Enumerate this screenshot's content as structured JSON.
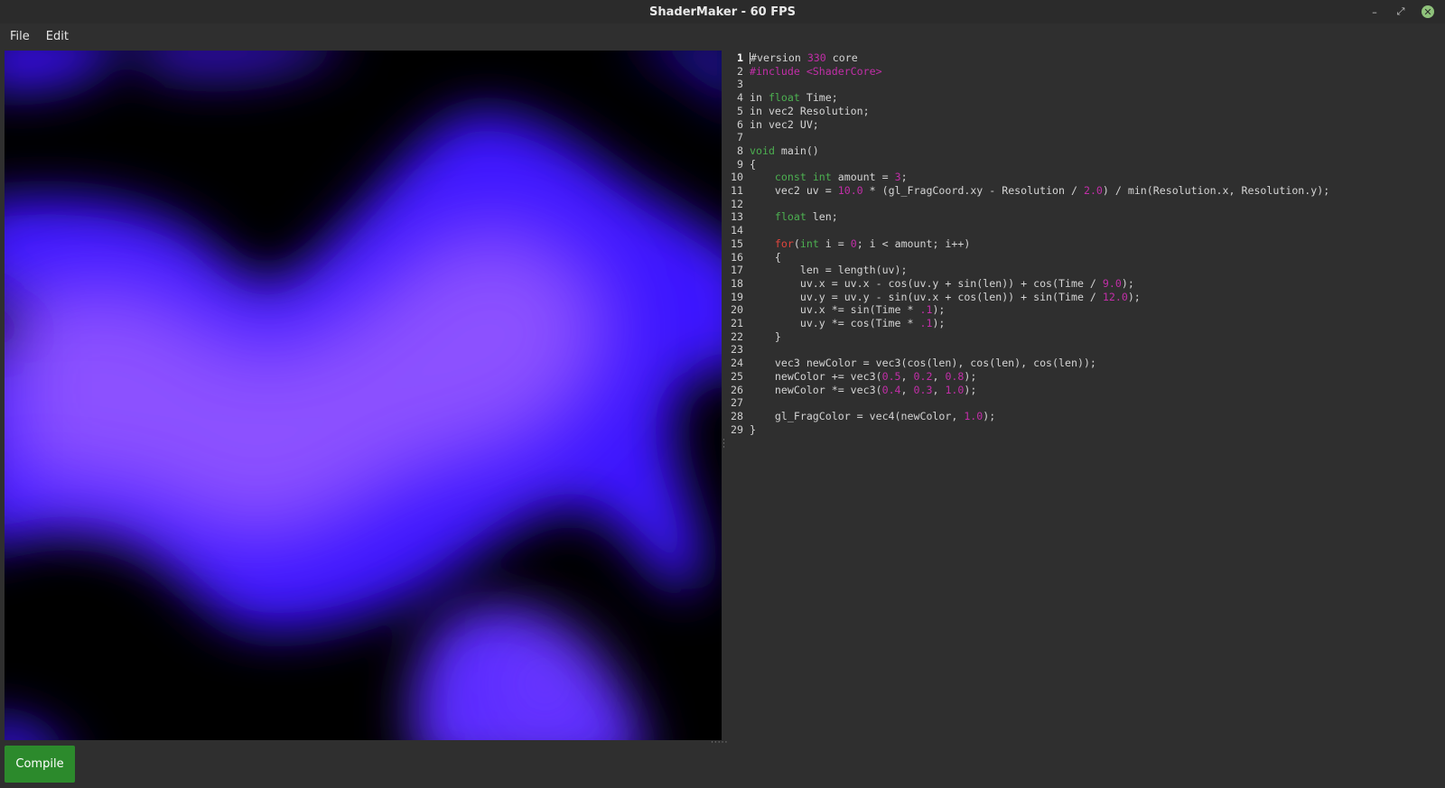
{
  "window": {
    "title": "ShaderMaker - 60 FPS"
  },
  "menu": {
    "file": "File",
    "edit": "Edit"
  },
  "controls": {
    "minimize": "–",
    "maximize": "⤢",
    "close": "✕"
  },
  "preview": {
    "background": "#000000",
    "colors": [
      "#3c14ff",
      "#5a2bff",
      "#9a5cff"
    ]
  },
  "editor": {
    "active_line": 1,
    "lines": [
      [
        [
          "#version ",
          "t"
        ],
        [
          "330",
          "n"
        ],
        [
          " core",
          "t"
        ]
      ],
      [
        [
          "#include <ShaderCore>",
          "p"
        ]
      ],
      [],
      [
        [
          "in ",
          "t"
        ],
        [
          "float",
          "k"
        ],
        [
          " Time;",
          "t"
        ]
      ],
      [
        [
          "in vec2 Resolution;",
          "t"
        ]
      ],
      [
        [
          "in vec2 UV;",
          "t"
        ]
      ],
      [],
      [
        [
          "void",
          "k"
        ],
        [
          " main()",
          "t"
        ]
      ],
      [
        [
          "{",
          "t"
        ]
      ],
      [
        [
          "    ",
          "t"
        ],
        [
          "const",
          "k"
        ],
        [
          " ",
          "t"
        ],
        [
          "int",
          "k"
        ],
        [
          " amount = ",
          "t"
        ],
        [
          "3",
          "n"
        ],
        [
          ";",
          "t"
        ]
      ],
      [
        [
          "    vec2 uv = ",
          "t"
        ],
        [
          "10.0",
          "n"
        ],
        [
          " * (gl_FragCoord.xy - Resolution / ",
          "t"
        ],
        [
          "2.0",
          "n"
        ],
        [
          ") / min(Resolution.x, Resolution.y);",
          "t"
        ]
      ],
      [],
      [
        [
          "    ",
          "t"
        ],
        [
          "float",
          "k"
        ],
        [
          " len;",
          "t"
        ]
      ],
      [],
      [
        [
          "    ",
          "t"
        ],
        [
          "for",
          "c"
        ],
        [
          "(",
          "t"
        ],
        [
          "int",
          "k"
        ],
        [
          " i = ",
          "t"
        ],
        [
          "0",
          "n"
        ],
        [
          "; i < amount; i++)",
          "t"
        ]
      ],
      [
        [
          "    {",
          "t"
        ]
      ],
      [
        [
          "        len = length(uv);",
          "t"
        ]
      ],
      [
        [
          "        uv.x = uv.x - cos(uv.y + sin(len)) + cos(Time / ",
          "t"
        ],
        [
          "9.0",
          "n"
        ],
        [
          ");",
          "t"
        ]
      ],
      [
        [
          "        uv.y = uv.y - sin(uv.x + cos(len)) + sin(Time / ",
          "t"
        ],
        [
          "12.0",
          "n"
        ],
        [
          ");",
          "t"
        ]
      ],
      [
        [
          "        uv.x *= sin(Time * ",
          "t"
        ],
        [
          ".1",
          "n"
        ],
        [
          ");",
          "t"
        ]
      ],
      [
        [
          "        uv.y *= cos(Time * ",
          "t"
        ],
        [
          ".1",
          "n"
        ],
        [
          ");",
          "t"
        ]
      ],
      [
        [
          "    }",
          "t"
        ]
      ],
      [],
      [
        [
          "    vec3 newColor = vec3(cos(len), cos(len), cos(len));",
          "t"
        ]
      ],
      [
        [
          "    newColor += vec3(",
          "t"
        ],
        [
          "0.5",
          "n"
        ],
        [
          ", ",
          "t"
        ],
        [
          "0.2",
          "n"
        ],
        [
          ", ",
          "t"
        ],
        [
          "0.8",
          "n"
        ],
        [
          ");",
          "t"
        ]
      ],
      [
        [
          "    newColor *= vec3(",
          "t"
        ],
        [
          "0.4",
          "n"
        ],
        [
          ", ",
          "t"
        ],
        [
          "0.3",
          "n"
        ],
        [
          ", ",
          "t"
        ],
        [
          "1.0",
          "n"
        ],
        [
          ");",
          "t"
        ]
      ],
      [],
      [
        [
          "    gl_FragColor = vec4(newColor, ",
          "t"
        ],
        [
          "1.0",
          "n"
        ],
        [
          ");",
          "t"
        ]
      ],
      [
        [
          "}",
          "t"
        ]
      ]
    ]
  },
  "bottom": {
    "compile_label": "Compile"
  }
}
